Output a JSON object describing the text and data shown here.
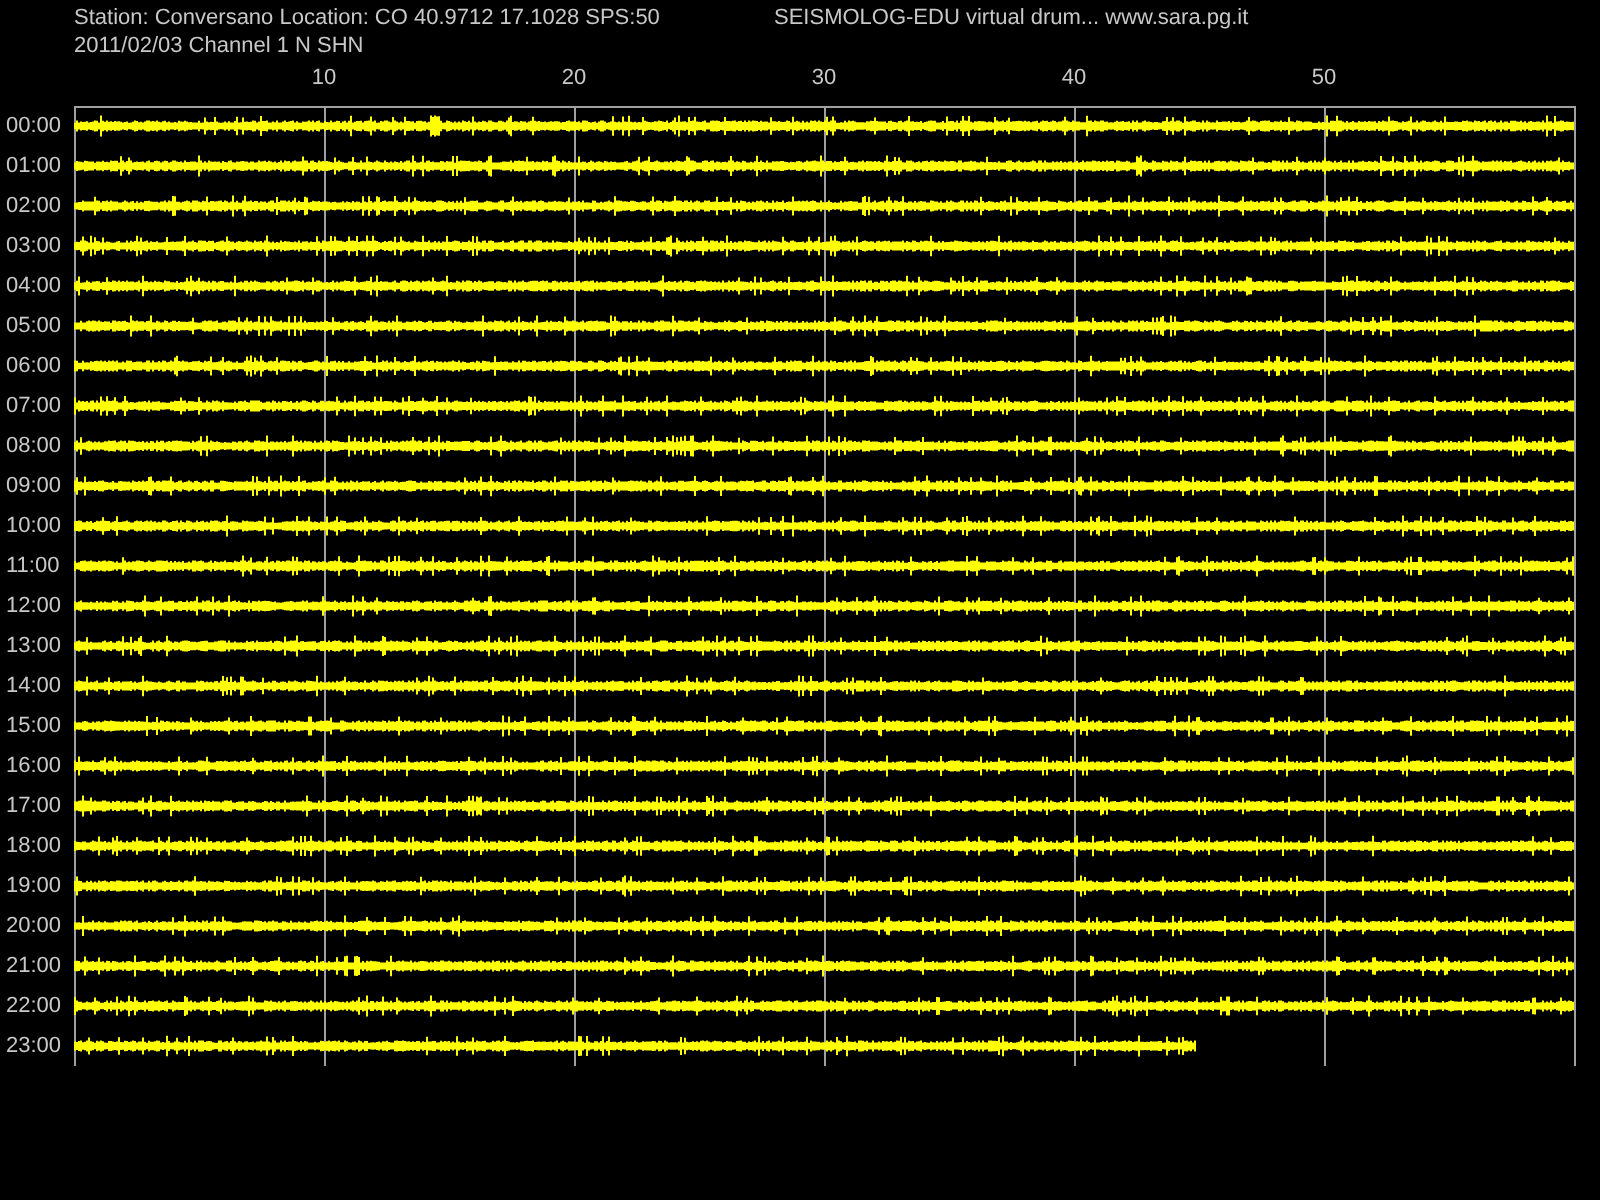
{
  "header": {
    "station_line": "Station: Conversano Location: CO 40.9712 17.1028 SPS:50",
    "app_line": "SEISMOLOG-EDU virtual drum... www.sara.pg.it",
    "date_line": "2011/02/03  Channel 1 N SHN"
  },
  "minute_ticks": [
    "10",
    "20",
    "30",
    "40",
    "50"
  ],
  "rows": [
    {
      "time": "00:00",
      "level": 1
    },
    {
      "time": "01:00",
      "level": 1
    },
    {
      "time": "02:00",
      "level": 1
    },
    {
      "time": "03:00",
      "level": 1
    },
    {
      "time": "04:00",
      "level": 1
    },
    {
      "time": "05:00",
      "level": 1
    },
    {
      "time": "06:00",
      "level": 1
    },
    {
      "time": "07:00",
      "level": 1
    },
    {
      "time": "08:00",
      "level": 1
    },
    {
      "time": "09:00",
      "level": 1
    },
    {
      "time": "10:00",
      "level": 1
    },
    {
      "time": "11:00",
      "level": 1
    },
    {
      "time": "12:00",
      "level": 1
    },
    {
      "time": "13:00",
      "level": 1
    },
    {
      "time": "14:00",
      "level": 1
    },
    {
      "time": "15:00",
      "level": 1
    },
    {
      "time": "16:00",
      "level": 1
    },
    {
      "time": "17:00",
      "level": 1
    },
    {
      "time": "18:00",
      "level": 1
    },
    {
      "time": "19:00",
      "level": 1
    },
    {
      "time": "20:00",
      "level": 1
    },
    {
      "time": "21:00",
      "level": 1
    },
    {
      "time": "22:00",
      "level": 1
    },
    {
      "time": "23:00",
      "level": 0.748
    }
  ]
}
